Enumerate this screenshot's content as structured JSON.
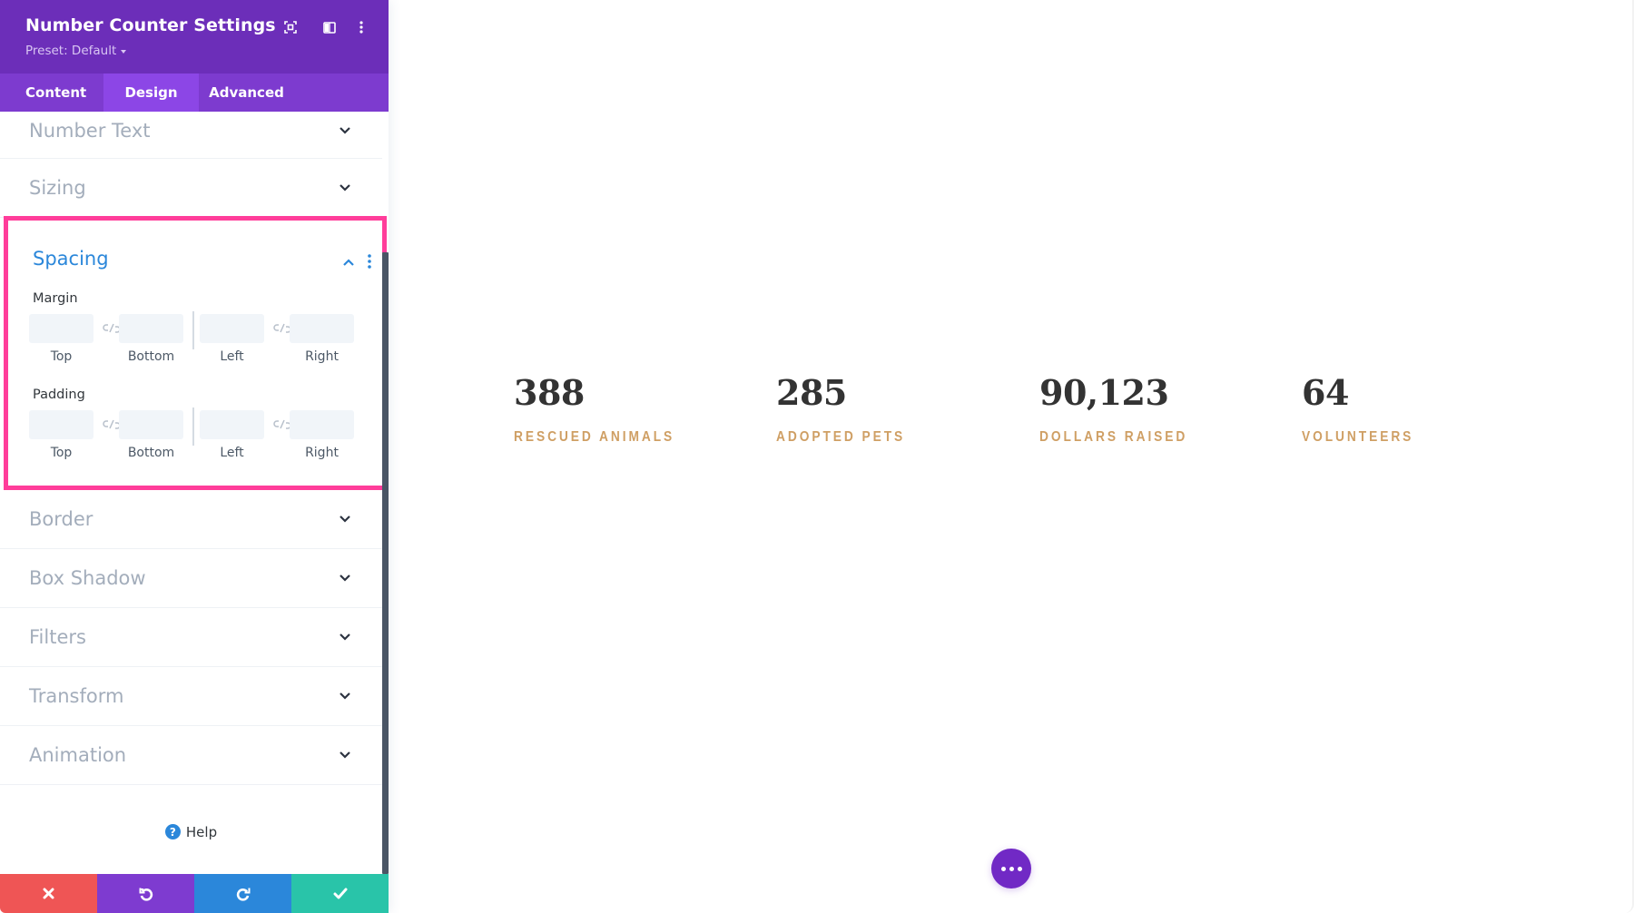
{
  "panel": {
    "title": "Number Counter Settings",
    "preset_label": "Preset: Default",
    "header_icons": [
      "focus-mode-icon",
      "split-view-icon",
      "more-options-icon"
    ],
    "tabs": [
      {
        "label": "Content",
        "active": false
      },
      {
        "label": "Design",
        "active": true
      },
      {
        "label": "Advanced",
        "active": false
      }
    ],
    "sections_above": [
      {
        "label": "Number Text",
        "expanded": false
      },
      {
        "label": "Sizing",
        "expanded": false
      }
    ],
    "spacing": {
      "label": "Spacing",
      "expanded": true,
      "margin": {
        "label": "Margin",
        "fields": [
          {
            "label": "Top",
            "value": ""
          },
          {
            "label": "Bottom",
            "value": ""
          },
          {
            "label": "Left",
            "value": ""
          },
          {
            "label": "Right",
            "value": ""
          }
        ]
      },
      "padding": {
        "label": "Padding",
        "fields": [
          {
            "label": "Top",
            "value": ""
          },
          {
            "label": "Bottom",
            "value": ""
          },
          {
            "label": "Left",
            "value": ""
          },
          {
            "label": "Right",
            "value": ""
          }
        ]
      }
    },
    "sections_below": [
      {
        "label": "Border",
        "expanded": false
      },
      {
        "label": "Box Shadow",
        "expanded": false
      },
      {
        "label": "Filters",
        "expanded": false
      },
      {
        "label": "Transform",
        "expanded": false
      },
      {
        "label": "Animation",
        "expanded": false
      }
    ],
    "help_label": "Help",
    "footer": {
      "cancel": "cancel-icon",
      "undo": "undo-icon",
      "redo": "redo-icon",
      "save": "save-icon"
    }
  },
  "colors": {
    "header": "#6c2eb9",
    "tabs": "#7d3bcf",
    "tab_active": "#8c46e6",
    "highlight_border": "#ff3d9a",
    "accent_blue": "#2b87da",
    "counter_label": "#cf9f64",
    "cancel": "#ef5555",
    "undo": "#7e3bd0",
    "redo": "#2b87da",
    "save": "#29c4a9"
  },
  "counters": [
    {
      "number": "388",
      "label": "RESCUED ANIMALS"
    },
    {
      "number": "285",
      "label": "ADOPTED PETS"
    },
    {
      "number": "90,123",
      "label": "DOLLARS RAISED"
    },
    {
      "number": "64",
      "label": "VOLUNTEERS"
    }
  ]
}
